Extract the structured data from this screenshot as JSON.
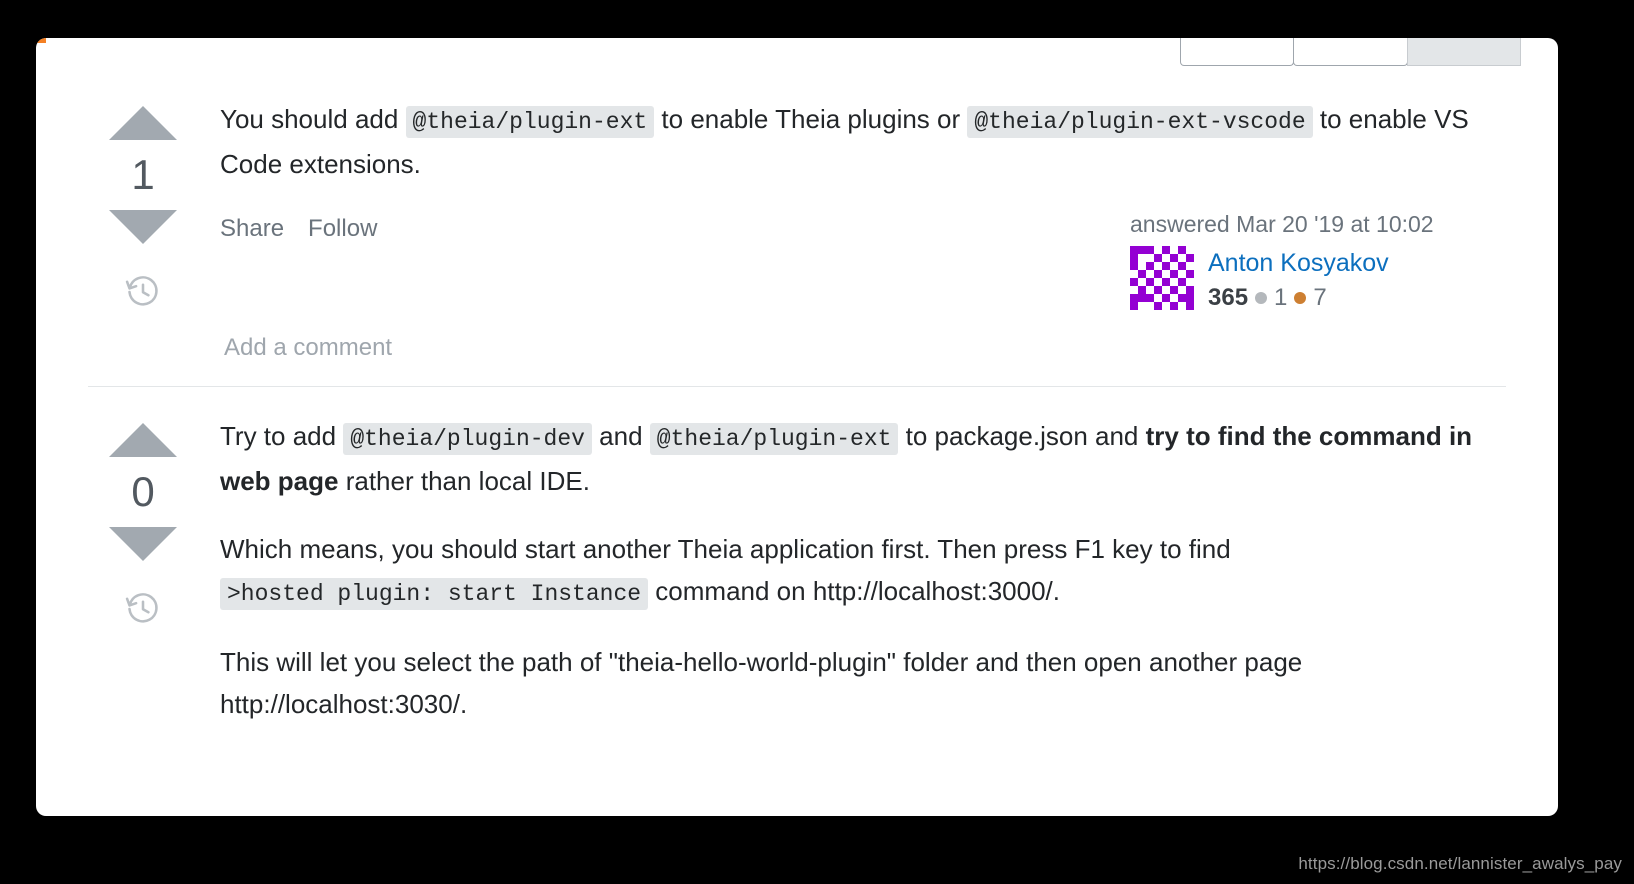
{
  "watermark": "https://blog.csdn.net/lannister_awalys_pay",
  "button_group": {
    "buttons": [
      {
        "label": "",
        "selected": false
      },
      {
        "label": "",
        "selected": false
      },
      {
        "label": "",
        "selected": true
      }
    ]
  },
  "answers": [
    {
      "vote_count": "1",
      "up_icon": "triangle-up-icon",
      "down_icon": "triangle-down-icon",
      "history_icon": "history-clock-icon",
      "paragraphs": [
        {
          "parts": [
            {
              "type": "text",
              "value": "You should add "
            },
            {
              "type": "code",
              "value": "@theia/plugin-ext"
            },
            {
              "type": "text",
              "value": " to enable Theia plugins or "
            },
            {
              "type": "code",
              "value": "@theia/plugin-ext-vscode"
            },
            {
              "type": "text",
              "value": " to enable VS Code extensions."
            }
          ]
        }
      ],
      "actions": [
        "Share",
        "Follow"
      ],
      "answered_line": "answered Mar 20 '19 at 10:02",
      "author": {
        "name": "Anton Kosyakov",
        "reputation": "365",
        "silver_badges": "1",
        "bronze_badges": "7",
        "avatar_color": "#9400d3"
      },
      "add_comment": "Add a comment"
    },
    {
      "vote_count": "0",
      "up_icon": "triangle-up-icon",
      "down_icon": "triangle-down-icon",
      "history_icon": "history-clock-icon",
      "paragraphs": [
        {
          "parts": [
            {
              "type": "text",
              "value": "Try to add "
            },
            {
              "type": "code",
              "value": "@theia/plugin-dev"
            },
            {
              "type": "text",
              "value": " and "
            },
            {
              "type": "code",
              "value": "@theia/plugin-ext"
            },
            {
              "type": "text",
              "value": " to package.json and "
            },
            {
              "type": "bold",
              "value": "try to find the command in web page"
            },
            {
              "type": "text",
              "value": " rather than local IDE."
            }
          ]
        },
        {
          "parts": [
            {
              "type": "text",
              "value": "Which means, you should start another Theia application first. Then press F1 key to find "
            },
            {
              "type": "code",
              "value": ">hosted plugin: start Instance"
            },
            {
              "type": "text",
              "value": " command on http://localhost:3000/."
            }
          ]
        },
        {
          "parts": [
            {
              "type": "text",
              "value": "This will let you select the path of \"theia-hello-world-plugin\" folder and then open another page http://localhost:3030/."
            }
          ]
        }
      ],
      "actions": [],
      "answered_line": "",
      "author": null,
      "add_comment": ""
    }
  ]
}
